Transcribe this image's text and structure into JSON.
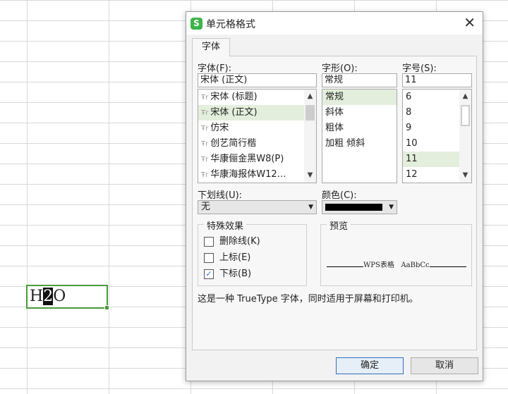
{
  "spreadsheet": {
    "cell_text_before": "H",
    "cell_text_selected": "2",
    "cell_text_after": "O"
  },
  "dialog": {
    "title": "单元格格式",
    "app_icon_letter": "S",
    "close_symbol": "✕",
    "tab": "字体",
    "font": {
      "label": "字体(F):",
      "value": "宋体 (正文)",
      "items": [
        "宋体 (标题)",
        "宋体 (正文)",
        "仿宋",
        "创艺简行楷",
        "华康俪金黑W8(P)",
        "华康海报体W12…"
      ],
      "selected_index": 1
    },
    "style": {
      "label": "字形(O):",
      "value": "常规",
      "items": [
        "常规",
        "斜体",
        "粗体",
        "加粗 倾斜"
      ],
      "selected_index": 0
    },
    "size": {
      "label": "字号(S):",
      "value": "11",
      "items": [
        "6",
        "8",
        "9",
        "10",
        "11",
        "12"
      ],
      "selected_index": 4
    },
    "underline": {
      "label": "下划线(U):",
      "value": "无"
    },
    "color": {
      "label": "颜色(C):",
      "value": "#000000"
    },
    "effects": {
      "legend": "特殊效果",
      "strikethrough": {
        "label": "删除线(K)",
        "checked": false
      },
      "superscript": {
        "label": "上标(E)",
        "checked": false
      },
      "subscript": {
        "label": "下标(B)",
        "checked": true
      }
    },
    "preview": {
      "legend": "预览",
      "sample_a": "WPS表格",
      "sample_b": "AaBbCc"
    },
    "note": "这是一种 TrueType 字体，同时适用于屏幕和打印机。",
    "ok_button": "确定",
    "cancel_button": "取消"
  },
  "colors": {
    "accent_green": "#4a9a3a",
    "selection_bg": "#e3efdc",
    "primary_border": "#2f6fbd"
  }
}
